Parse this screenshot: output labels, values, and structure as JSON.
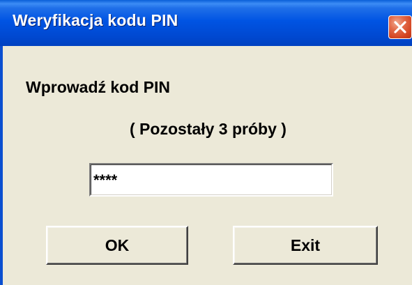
{
  "window": {
    "title": "Weryfikacja kodu PIN",
    "close_icon": "close-icon"
  },
  "dialog": {
    "prompt": "Wprowadź kod PIN",
    "attempts_remaining": "( Pozostały 3 próby )",
    "pin_value": "****"
  },
  "buttons": {
    "ok_label": "OK",
    "exit_label": "Exit"
  },
  "colors": {
    "titlebar": "#0054e3",
    "close_button": "#d2421f",
    "window_background": "#ece9d8"
  }
}
